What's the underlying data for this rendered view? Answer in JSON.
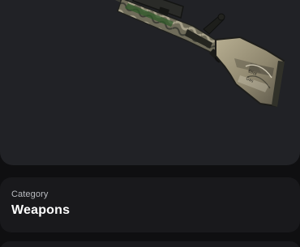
{
  "item_image": {
    "icon": "rifle-skin-image"
  },
  "details": {
    "category_label": "Category",
    "category_value": "Weapons"
  },
  "colors": {
    "card_background": "#212226",
    "info_background": "#19191c",
    "page_background": "#0f0f11"
  }
}
